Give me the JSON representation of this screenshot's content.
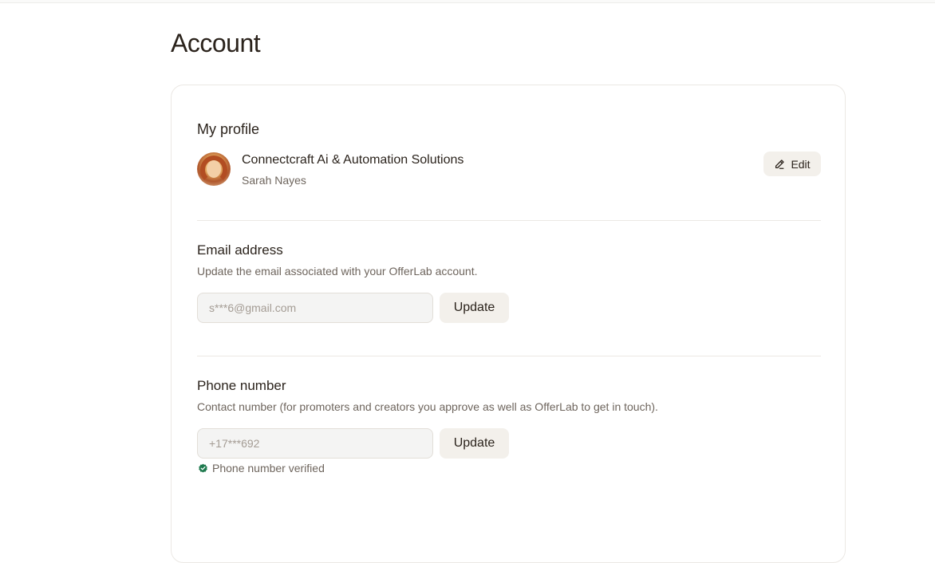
{
  "page": {
    "title": "Account"
  },
  "profile": {
    "section_title": "My profile",
    "company_name": "Connectcraft Ai & Automation Solutions",
    "user_name": "Sarah Nayes",
    "edit_label": "Edit",
    "edit_icon": "pencil-icon"
  },
  "email": {
    "section_title": "Email address",
    "description": "Update the email associated with your OfferLab account.",
    "placeholder": "s***6@gmail.com",
    "update_label": "Update"
  },
  "phone": {
    "section_title": "Phone number",
    "description": "Contact number (for promoters and creators you approve as well as OfferLab to get in touch).",
    "placeholder": "+17***692",
    "update_label": "Update",
    "verified_text": "Phone number verified",
    "verified_icon": "verified-badge-icon",
    "verified_color": "#1f7a4f"
  },
  "colors": {
    "text": "#2b231c",
    "muted": "#6e655d",
    "button_bg": "#f3f0eb",
    "border": "#ebe8e4"
  }
}
